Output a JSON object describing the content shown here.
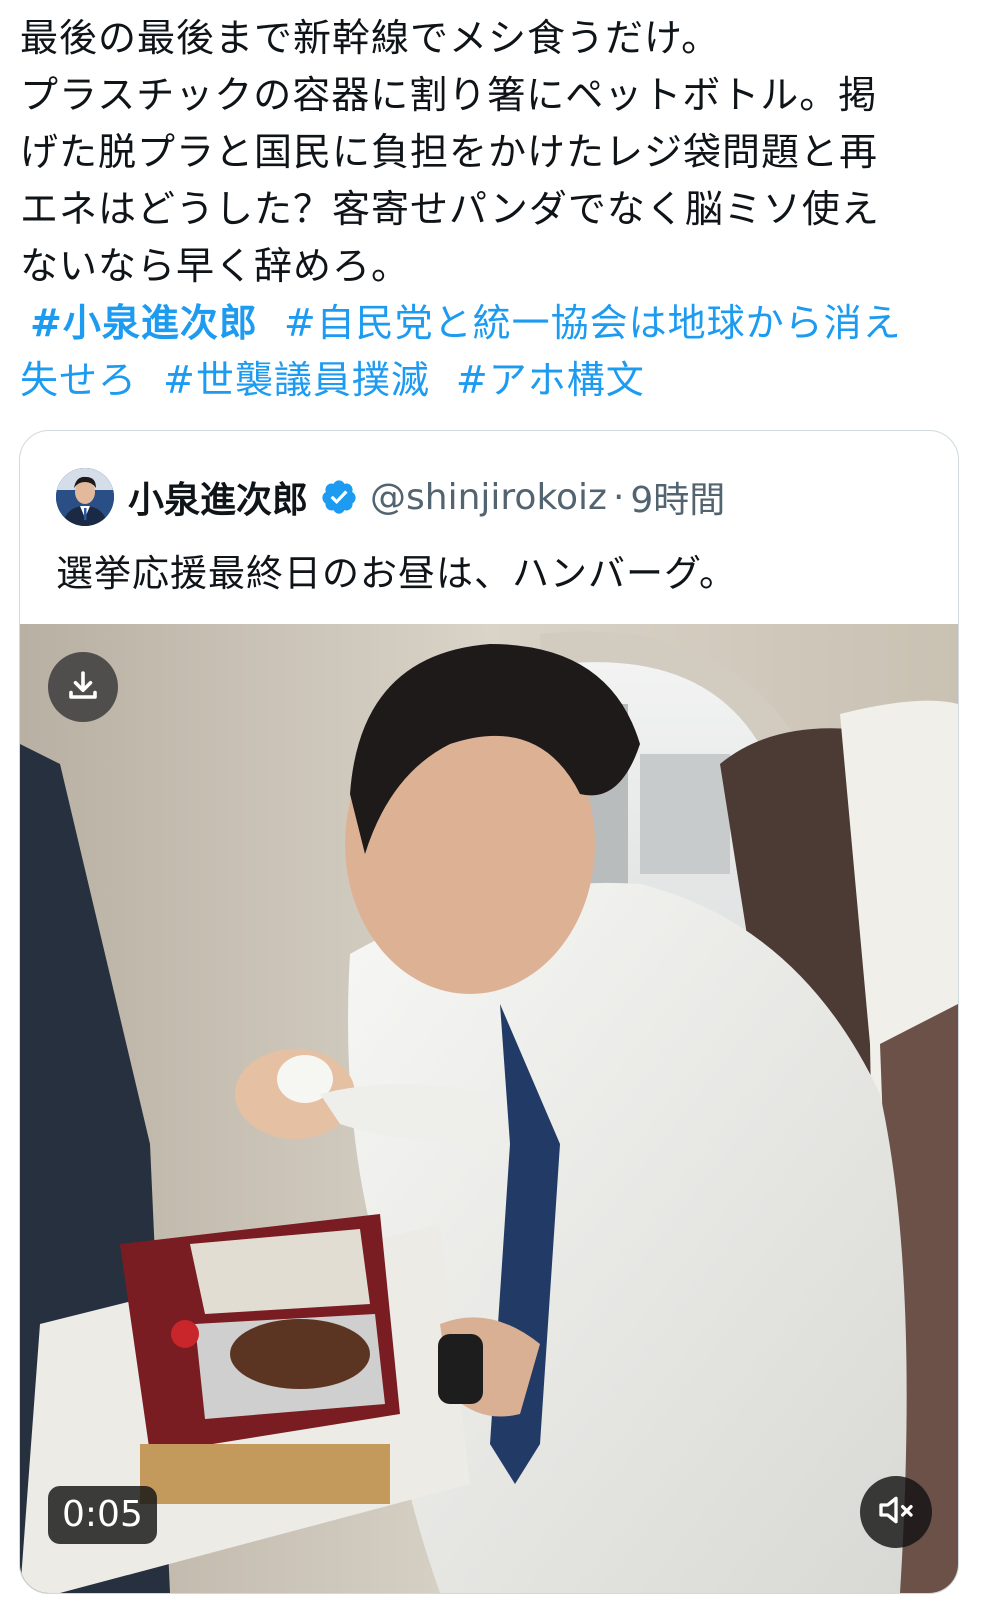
{
  "tweet": {
    "lines": [
      "最後の最後まで新幹線でメシ食うだけ。",
      "プラスチックの容器に割り箸にペットボトル。掲",
      "げた脱プラと国民に負担をかけたレジ袋問題と再",
      "エネはどうした？客寄せパンダでなく脳ミソ使え",
      "ないなら早く辞めろ。"
    ],
    "hashtags": [
      "#小泉進次郎",
      "#自民党と統一協会は地球から消え",
      "失せろ",
      "#世襲議員撲滅",
      "#アホ構文"
    ]
  },
  "quoted_tweet": {
    "display_name": "小泉進次郎",
    "handle": "@shinjirokoiz",
    "separator": "·",
    "time": "9時間",
    "text": "選挙応援最終日のお昼は、ハンバーグ。",
    "video": {
      "elapsed": "0:05",
      "download_icon": "download-icon",
      "mute_icon": "muted-speaker-icon"
    }
  },
  "colors": {
    "link": "#1d9bf0",
    "text": "#0f1419",
    "secondary": "#536471",
    "verified": "#1d9bf0",
    "border": "#cfd9de"
  }
}
